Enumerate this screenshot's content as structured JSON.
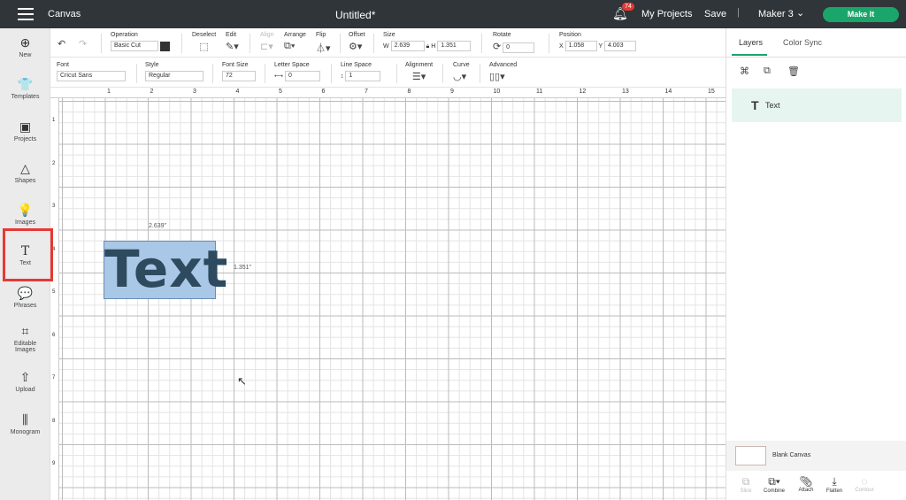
{
  "header": {
    "app": "Canvas",
    "title": "Untitled*",
    "notifications": "74",
    "my_projects": "My Projects",
    "save": "Save",
    "machine": "Maker 3",
    "make_it": "Make It"
  },
  "sidebar": [
    {
      "label": "New",
      "icon": "⊕"
    },
    {
      "label": "Templates",
      "icon": "👕"
    },
    {
      "label": "Projects",
      "icon": "▣"
    },
    {
      "label": "Shapes",
      "icon": "△"
    },
    {
      "label": "Images",
      "icon": "💡"
    },
    {
      "label": "Text",
      "icon": "T"
    },
    {
      "label": "Phrases",
      "icon": "💬"
    },
    {
      "label": "Editable",
      "label2": "Images",
      "icon": "⌗"
    },
    {
      "label": "Upload",
      "icon": "⇧"
    },
    {
      "label": "Monogram",
      "icon": "⫼"
    }
  ],
  "toolbar1": {
    "operation_label": "Operation",
    "operation": "Basic Cut",
    "deselect": "Deselect",
    "edit": "Edit",
    "align": "Align",
    "arrange": "Arrange",
    "flip": "Flip",
    "offset": "Offset",
    "size": "Size",
    "w_label": "W",
    "w": "2.639",
    "h_label": "H",
    "h": "1.351",
    "rotate": "Rotate",
    "rotate_val": "0",
    "position": "Position",
    "x_label": "X",
    "x": "1.058",
    "y_label": "Y",
    "y": "4.003"
  },
  "toolbar2": {
    "font_label": "Font",
    "font": "Cricut Sans",
    "style_label": "Style",
    "style": "Regular",
    "size_label": "Font Size",
    "size": "72",
    "letter_label": "Letter Space",
    "letter": "0",
    "line_label": "Line Space",
    "line": "1",
    "alignment": "Alignment",
    "curve": "Curve",
    "advanced": "Advanced"
  },
  "ruler": [
    "1",
    "2",
    "3",
    "4",
    "5",
    "6",
    "7",
    "8",
    "9",
    "10",
    "11",
    "12",
    "13",
    "14",
    "15"
  ],
  "ruler_v": [
    "1",
    "2",
    "3",
    "4",
    "5",
    "6",
    "7",
    "8",
    "9"
  ],
  "canvas": {
    "text": "Text",
    "width_label": "2.639\"",
    "height_label": "1.351\"",
    "fill": "#a9c7e6"
  },
  "panel": {
    "tab_layers": "Layers",
    "tab_color": "Color Sync",
    "layer_name": "Text",
    "blank_canvas": "Blank Canvas",
    "actions": [
      "Slice",
      "Combine",
      "Attach",
      "Flatten",
      "Contour"
    ]
  }
}
